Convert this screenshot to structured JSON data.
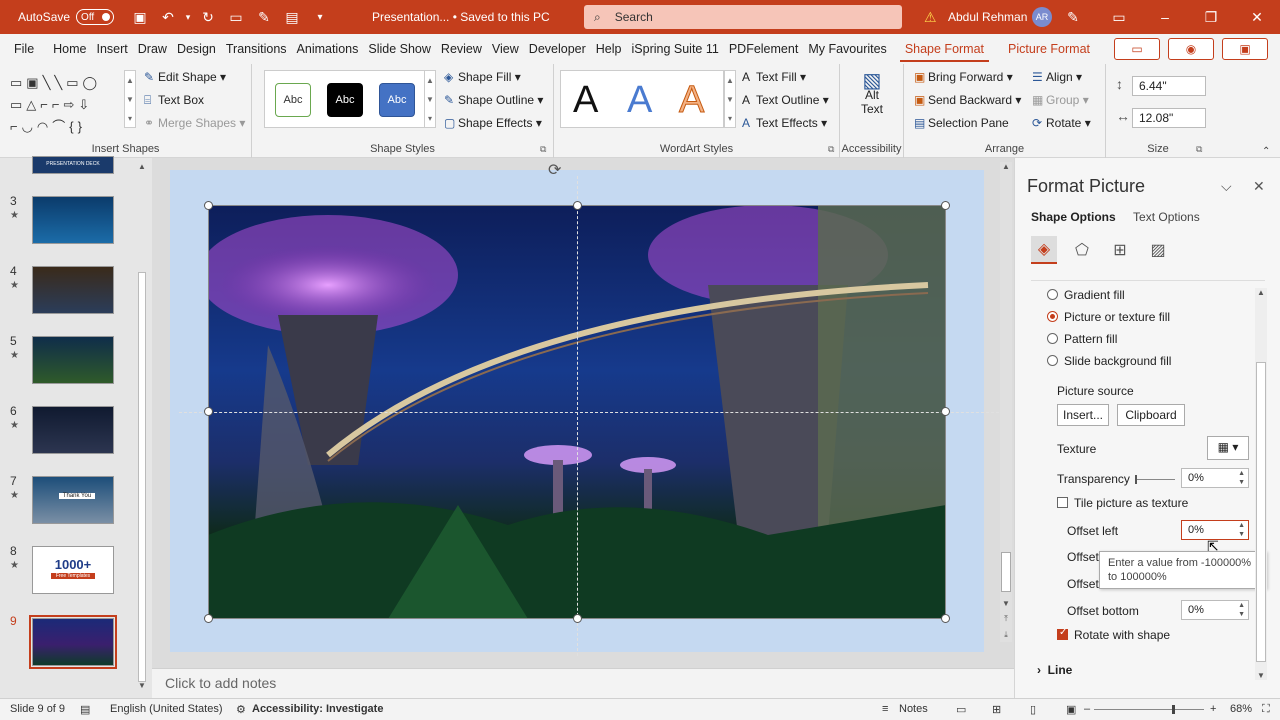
{
  "titlebar": {
    "autosave": "AutoSave",
    "toggle": "Off",
    "filename": "Presentation... • Saved to this PC",
    "search": "Search",
    "user": "Abdul Rehman",
    "avatar": "AR"
  },
  "menu": {
    "tabs": [
      "File",
      "Home",
      "Insert",
      "Draw",
      "Design",
      "Transitions",
      "Animations",
      "Slide Show",
      "Review",
      "View",
      "Developer",
      "Help",
      "iSpring Suite 11",
      "PDFelement",
      "My Favourites"
    ],
    "active_tab": "Shape Format",
    "context_tab": "Picture Format"
  },
  "ribbon": {
    "insert_shapes": {
      "label": "Insert Shapes",
      "edit_shape": "Edit Shape",
      "text_box": "Text Box",
      "merge_shapes": "Merge Shapes"
    },
    "shape_styles": {
      "label": "Shape Styles",
      "preset": [
        "Abc",
        "Abc",
        "Abc"
      ],
      "shape_fill": "Shape Fill",
      "shape_outline": "Shape Outline",
      "shape_effects": "Shape Effects"
    },
    "wordart": {
      "label": "WordArt Styles",
      "letters": [
        "A",
        "A",
        "A"
      ],
      "text_fill": "Text Fill",
      "text_outline": "Text Outline",
      "text_effects": "Text Effects"
    },
    "accessibility": {
      "label": "Accessibility",
      "alt_text_1": "Alt",
      "alt_text_2": "Text"
    },
    "arrange": {
      "label": "Arrange",
      "bring_forward": "Bring Forward",
      "send_backward": "Send Backward",
      "selection_pane": "Selection Pane",
      "align": "Align",
      "group": "Group",
      "rotate": "Rotate"
    },
    "size": {
      "label": "Size",
      "height": "6.44\"",
      "width": "12.08\""
    }
  },
  "thumbnails": [
    {
      "num": "3"
    },
    {
      "num": "4"
    },
    {
      "num": "5"
    },
    {
      "num": "6"
    },
    {
      "num": "7"
    },
    {
      "num": "8"
    },
    {
      "num": "9"
    }
  ],
  "thumb_text": {
    "deck": "PRESENTATION DECK",
    "thanks": "Thank You",
    "templates_big": "1000+",
    "templates_small": "Free Templates"
  },
  "notes": {
    "placeholder": "Click to add notes"
  },
  "pane": {
    "title": "Format Picture",
    "tabs": [
      "Shape Options",
      "Text Options"
    ],
    "fill_options": [
      "Gradient fill",
      "Picture or texture fill",
      "Pattern fill",
      "Slide background fill"
    ],
    "picture_source": "Picture source",
    "insert_btn": "Insert...",
    "clipboard_btn": "Clipboard",
    "texture": "Texture",
    "transparency": "Transparency",
    "transparency_val": "0%",
    "tile": "Tile picture as texture",
    "offset_left": "Offset left",
    "offset_left_val": "0%",
    "offset_right": "Offset",
    "offset_top": "Offset",
    "offset_bottom": "Offset bottom",
    "offset_bottom_val": "0%",
    "tooltip": "Enter a value from -100000% to 100000%",
    "rotate_with_shape": "Rotate with shape",
    "line": "Line"
  },
  "status": {
    "slide": "Slide 9 of 9",
    "language": "English (United States)",
    "accessibility": "Accessibility: Investigate",
    "notes": "Notes",
    "zoom": "68%"
  },
  "colors": {
    "accent": "#c43e1c",
    "titlebar": "#c43e1c",
    "slide_bg": "#c5d9f1"
  }
}
